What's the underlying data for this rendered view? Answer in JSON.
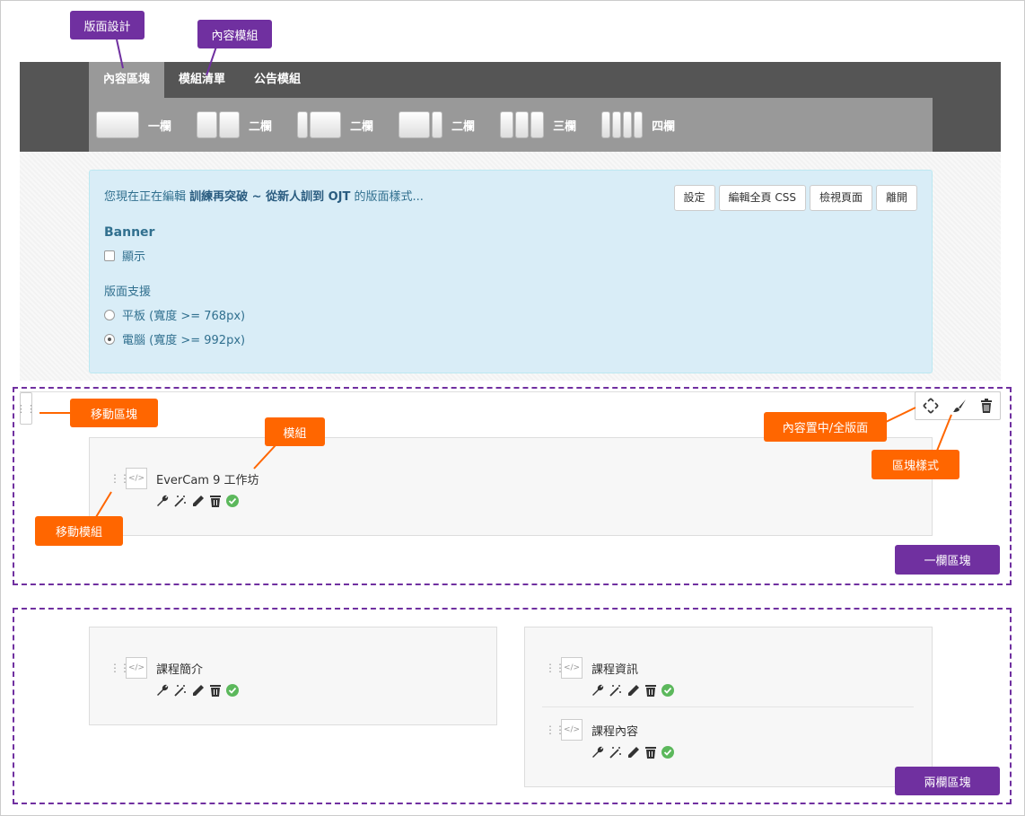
{
  "nav": {
    "tabs": [
      {
        "label": "內容區塊",
        "active": true
      },
      {
        "label": "模組清單",
        "active": false
      },
      {
        "label": "公告模組",
        "active": false
      }
    ],
    "layouts": [
      {
        "label": "一欄"
      },
      {
        "label": "二欄"
      },
      {
        "label": "二欄"
      },
      {
        "label": "二欄"
      },
      {
        "label": "三欄"
      },
      {
        "label": "四欄"
      }
    ]
  },
  "panel": {
    "intro_prefix": "您現在正在編輯",
    "course_name": "訓練再突破 ~ 從新人訓到 OJT",
    "intro_suffix": "的版面樣式...",
    "buttons": {
      "settings": "設定",
      "edit_css": "編輯全頁 CSS",
      "view_page": "檢視頁面",
      "leave": "離開"
    },
    "banner_title": "Banner",
    "banner_show": "顯示",
    "layout_support_title": "版面支援",
    "tablet_option": "平板 (寬度 >= 768px)",
    "desktop_option": "電腦 (寬度 >= 992px)"
  },
  "blocks": {
    "one_col_module": "EverCam 9 工作坊",
    "two_col_left_module": "課程簡介",
    "two_col_right_modules": [
      "課程資訊",
      "課程內容"
    ]
  },
  "callouts": {
    "layout_design": "版面設計",
    "content_modules": "內容模組",
    "move_block": "移動區塊",
    "module": "模組",
    "content_center_full": "內容置中/全版面",
    "block_style": "區塊樣式",
    "move_module": "移動模組",
    "one_col_block": "一欄區塊",
    "two_col_block": "兩欄區塊"
  },
  "code_glyph": "</>",
  "colors": {
    "callout_purple": "#7030a0",
    "callout_orange": "#ff6600",
    "topbar": "#555555",
    "tab_active": "#999999",
    "panel_bg": "#d9edf7",
    "check_green": "#5cb85c"
  }
}
